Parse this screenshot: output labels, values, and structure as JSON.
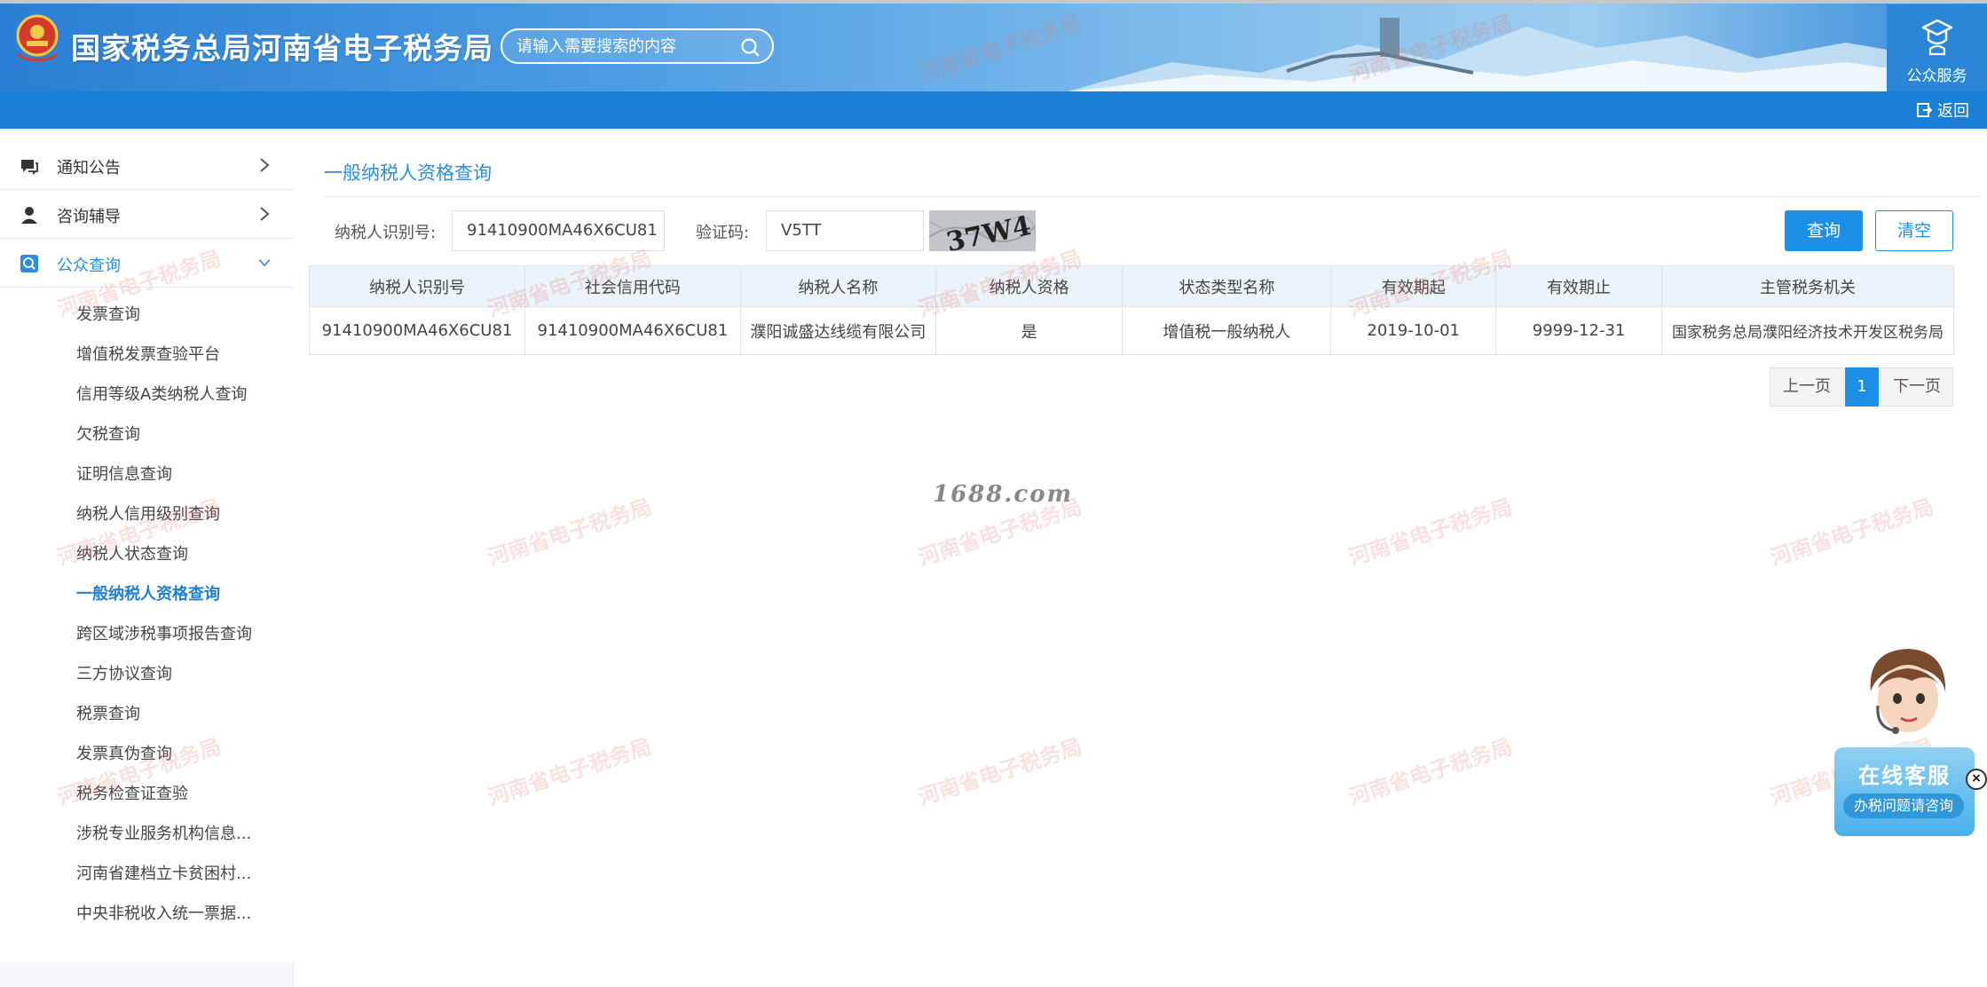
{
  "header": {
    "site_title": "国家税务总局河南省电子税务局",
    "search_placeholder": "请输入需要搜索的内容",
    "public_service_label": "公众服务",
    "return_label": "返回"
  },
  "sidebar": {
    "top_items": [
      {
        "label": "通知公告",
        "icon": "announcement-icon"
      },
      {
        "label": "咨询辅导",
        "icon": "consultant-icon"
      },
      {
        "label": "公众查询",
        "icon": "search-icon"
      }
    ],
    "sub_items": [
      "发票查询",
      "增值税发票查验平台",
      "信用等级A类纳税人查询",
      "欠税查询",
      "证明信息查询",
      "纳税人信用级别查询",
      "纳税人状态查询",
      "一般纳税人资格查询",
      "跨区域涉税事项报告查询",
      "三方协议查询",
      "税票查询",
      "发票真伪查询",
      "税务检查证查验",
      "涉税专业服务机构信息...",
      "河南省建档立卡贫困村...",
      "中央非税收入统一票据..."
    ],
    "current_index": 7
  },
  "main": {
    "heading": "一般纳税人资格查询",
    "form": {
      "taxpayer_id_label": "纳税人识别号:",
      "taxpayer_id_value": "91410900MA46X6CU81",
      "captcha_label": "验证码:",
      "captcha_value": "V5TT",
      "captcha_text": "37W4",
      "query_label": "查询",
      "clear_label": "清空"
    },
    "table": {
      "headers": [
        "纳税人识别号",
        "社会信用代码",
        "纳税人名称",
        "纳税人资格",
        "状态类型名称",
        "有效期起",
        "有效期止",
        "主管税务机关"
      ],
      "rows": [
        [
          "91410900MA46X6CU81",
          "91410900MA46X6CU81",
          "濮阳诚盛达线缆有限公司",
          "是",
          "增值税一般纳税人",
          "2019-10-01",
          "9999-12-31",
          "国家税务总局濮阳经济技术开发区税务局"
        ]
      ]
    },
    "pager": {
      "prev": "上一页",
      "current": "1",
      "next": "下一页"
    }
  },
  "watermark_text": "河南省电子税务局",
  "watermark_1688": "1688.com",
  "customer_service": {
    "title": "在线客服",
    "subtitle": "办税问题请咨询",
    "close": "×"
  },
  "colors": {
    "accent": "#1e8fe6",
    "header_bar": "#1a7fd6",
    "sidebar_bg": "#f4f6f9",
    "table_head": "#ebf3fb"
  }
}
